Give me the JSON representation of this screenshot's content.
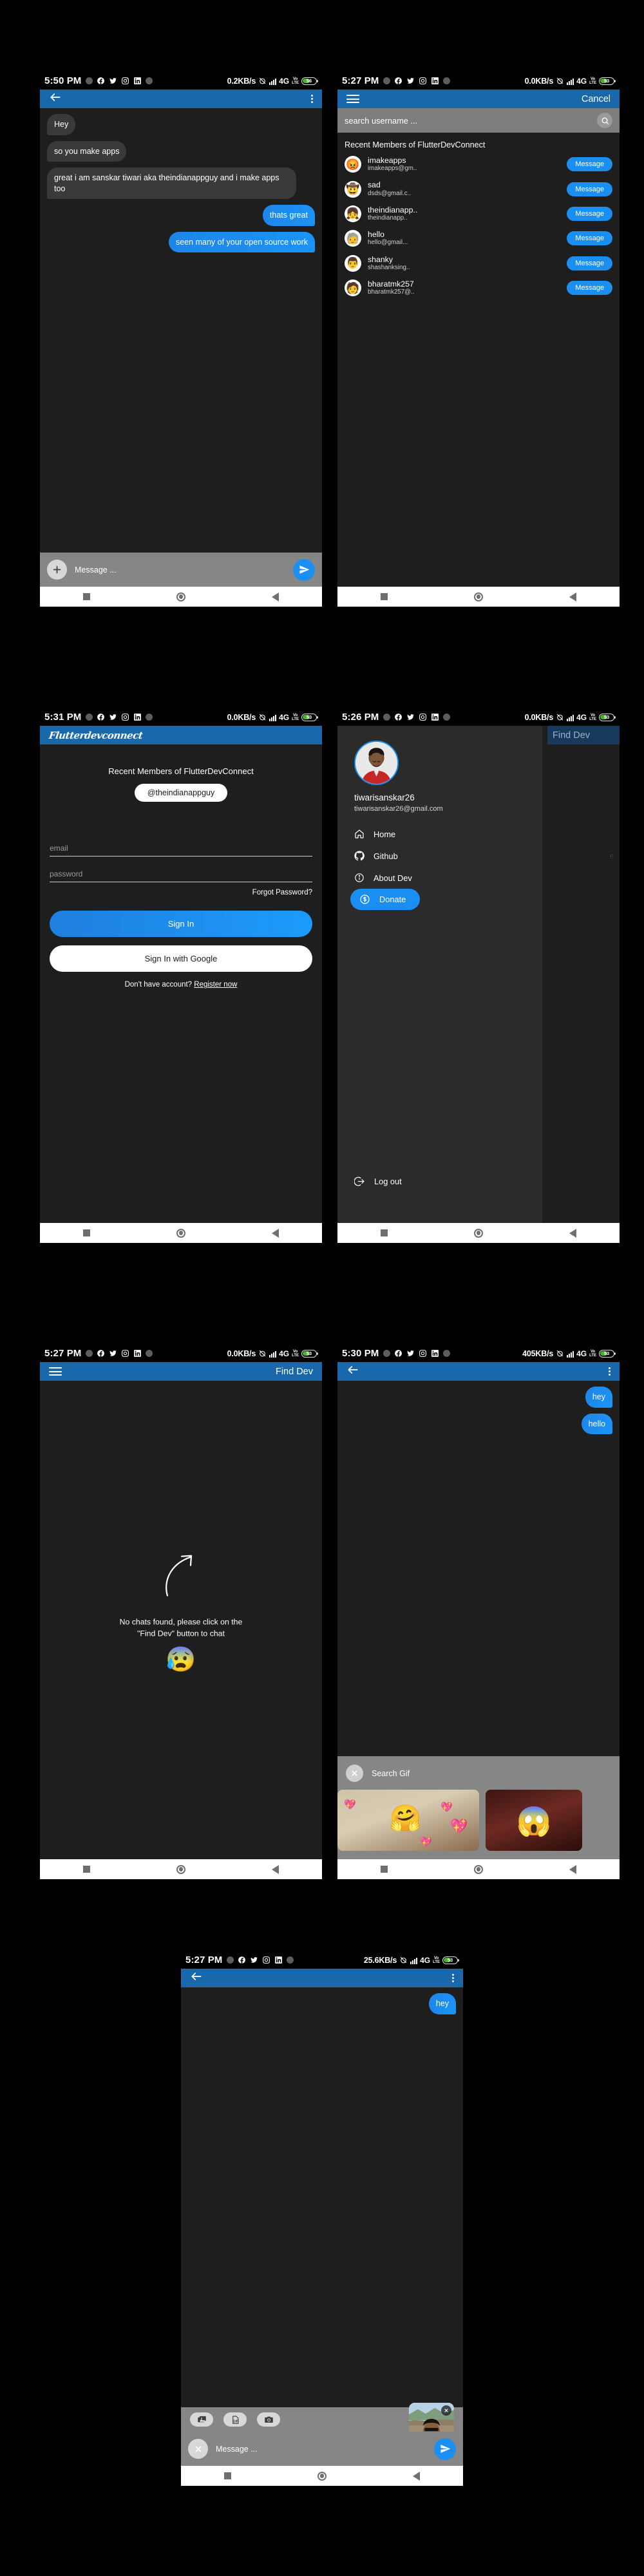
{
  "screens": [
    {
      "id": "chat-conversation",
      "status_bar": {
        "time": "5:50 PM",
        "speed": "0.2KB/s",
        "network": "4G",
        "volte": "VoLTE",
        "battery": "56"
      },
      "appbar": {
        "back_icon": "arrow-back-icon",
        "more_icon": "more-vert-icon"
      },
      "messages": [
        {
          "text": "Hey",
          "side": "in"
        },
        {
          "text": "so you make apps",
          "side": "in"
        },
        {
          "text": "great i am sanskar tiwari aka theindianappguy and i make apps too",
          "side": "in"
        },
        {
          "text": "thats great",
          "side": "out"
        },
        {
          "text": "seen many of your open source work",
          "side": "out"
        }
      ],
      "composer": {
        "add_icon": "plus-circle-icon",
        "placeholder": "Message ...",
        "send_icon": "send-icon"
      }
    },
    {
      "id": "find-dev-search",
      "status_bar": {
        "time": "5:27 PM",
        "speed": "0.0KB/s",
        "network": "4G",
        "volte": "VoLTE",
        "battery": "53"
      },
      "appbar": {
        "menu_icon": "hamburger-menu-icon",
        "action": "Cancel"
      },
      "search": {
        "placeholder": "search username ...",
        "icon": "search-icon"
      },
      "list_title": "Recent Members of FlutterDevConnect",
      "members": [
        {
          "name": "imakeapps",
          "email": "imakeapps@gm..",
          "avatar": "😡",
          "button": "Message"
        },
        {
          "name": "sad",
          "email": "dsds@gmail.c..",
          "avatar": "🤠",
          "button": "Message"
        },
        {
          "name": "theindianapp..",
          "email": "theindianapp..",
          "avatar": "👧",
          "button": "Message"
        },
        {
          "name": "hello",
          "email": "hello@gmail...",
          "avatar": "🧓",
          "button": "Message"
        },
        {
          "name": "shanky",
          "email": "shashanksing..",
          "avatar": "👨",
          "button": "Message"
        },
        {
          "name": "bharatmk257",
          "email": "bharatmk257@..",
          "avatar": "🧑",
          "button": "Message"
        }
      ]
    },
    {
      "id": "sign-in",
      "status_bar": {
        "time": "5:31 PM",
        "speed": "0.0KB/s",
        "network": "4G",
        "volte": "VoLTE",
        "battery": "53"
      },
      "appbar": {
        "logo": "Flutterdevconnect"
      },
      "heading": "Recent Members of FlutterDevConnect",
      "chip": "@theindianappguy",
      "email_placeholder": "email",
      "password_placeholder": "password",
      "forgot": "Forgot Password?",
      "sign_in": "Sign In",
      "sign_in_google": "Sign In with Google",
      "register_prefix": "Don't have account? ",
      "register_link": "Register now"
    },
    {
      "id": "navigation-drawer",
      "status_bar": {
        "time": "5:26 PM",
        "speed": "0.0KB/s",
        "network": "4G",
        "volte": "VoLTE",
        "battery": "53"
      },
      "behind_title": "Find Dev",
      "behind_hint": "e",
      "profile": {
        "name": "tiwarisanskar26",
        "email": "tiwarisanskar26@gmail.com",
        "avatar": "profile-photo"
      },
      "items": [
        {
          "label": "Home",
          "icon": "home-icon",
          "active": false
        },
        {
          "label": "Github",
          "icon": "github-icon",
          "active": false
        },
        {
          "label": "About Dev",
          "icon": "info-icon",
          "active": false
        },
        {
          "label": "Donate",
          "icon": "dollar-icon",
          "active": true
        }
      ],
      "logout": {
        "label": "Log out",
        "icon": "logout-icon"
      }
    },
    {
      "id": "empty-chats",
      "status_bar": {
        "time": "5:27 PM",
        "speed": "0.0KB/s",
        "network": "4G",
        "volte": "VoLTE",
        "battery": "53"
      },
      "appbar": {
        "menu_icon": "hamburger-menu-icon",
        "title": "Find Dev"
      },
      "empty_line1": "No chats found, please click on the",
      "empty_line2": "\"Find Dev\" button to chat",
      "empty_emoji": "😰"
    },
    {
      "id": "gif-picker",
      "status_bar": {
        "time": "5:30 PM",
        "speed": "405KB/s",
        "network": "4G",
        "volte": "VoLTE",
        "battery": "53"
      },
      "appbar": {
        "back_icon": "arrow-back-icon",
        "more_icon": "more-vert-icon"
      },
      "messages": [
        {
          "text": "hey",
          "side": "out"
        },
        {
          "text": "hello",
          "side": "out"
        }
      ],
      "gif": {
        "close_icon": "close-circle-icon",
        "placeholder": "Search Gif"
      }
    },
    {
      "id": "attachment-picker",
      "status_bar": {
        "time": "5:27 PM",
        "speed": "25.6KB/s",
        "network": "4G",
        "volte": "VoLTE",
        "battery": "53"
      },
      "appbar": {
        "back_icon": "arrow-back-icon",
        "more_icon": "more-vert-icon"
      },
      "messages": [
        {
          "text": "hey",
          "side": "out"
        }
      ],
      "attachments": [
        {
          "icon": "gallery-icon",
          "label": ""
        },
        {
          "icon": "gif-icon",
          "label": "GIF"
        },
        {
          "icon": "camera-icon",
          "label": ""
        }
      ],
      "thumb": {
        "remove_icon": "close-icon"
      },
      "composer": {
        "close_icon": "close-circle-icon",
        "placeholder": "Message ...",
        "send_icon": "send-icon"
      }
    }
  ]
}
